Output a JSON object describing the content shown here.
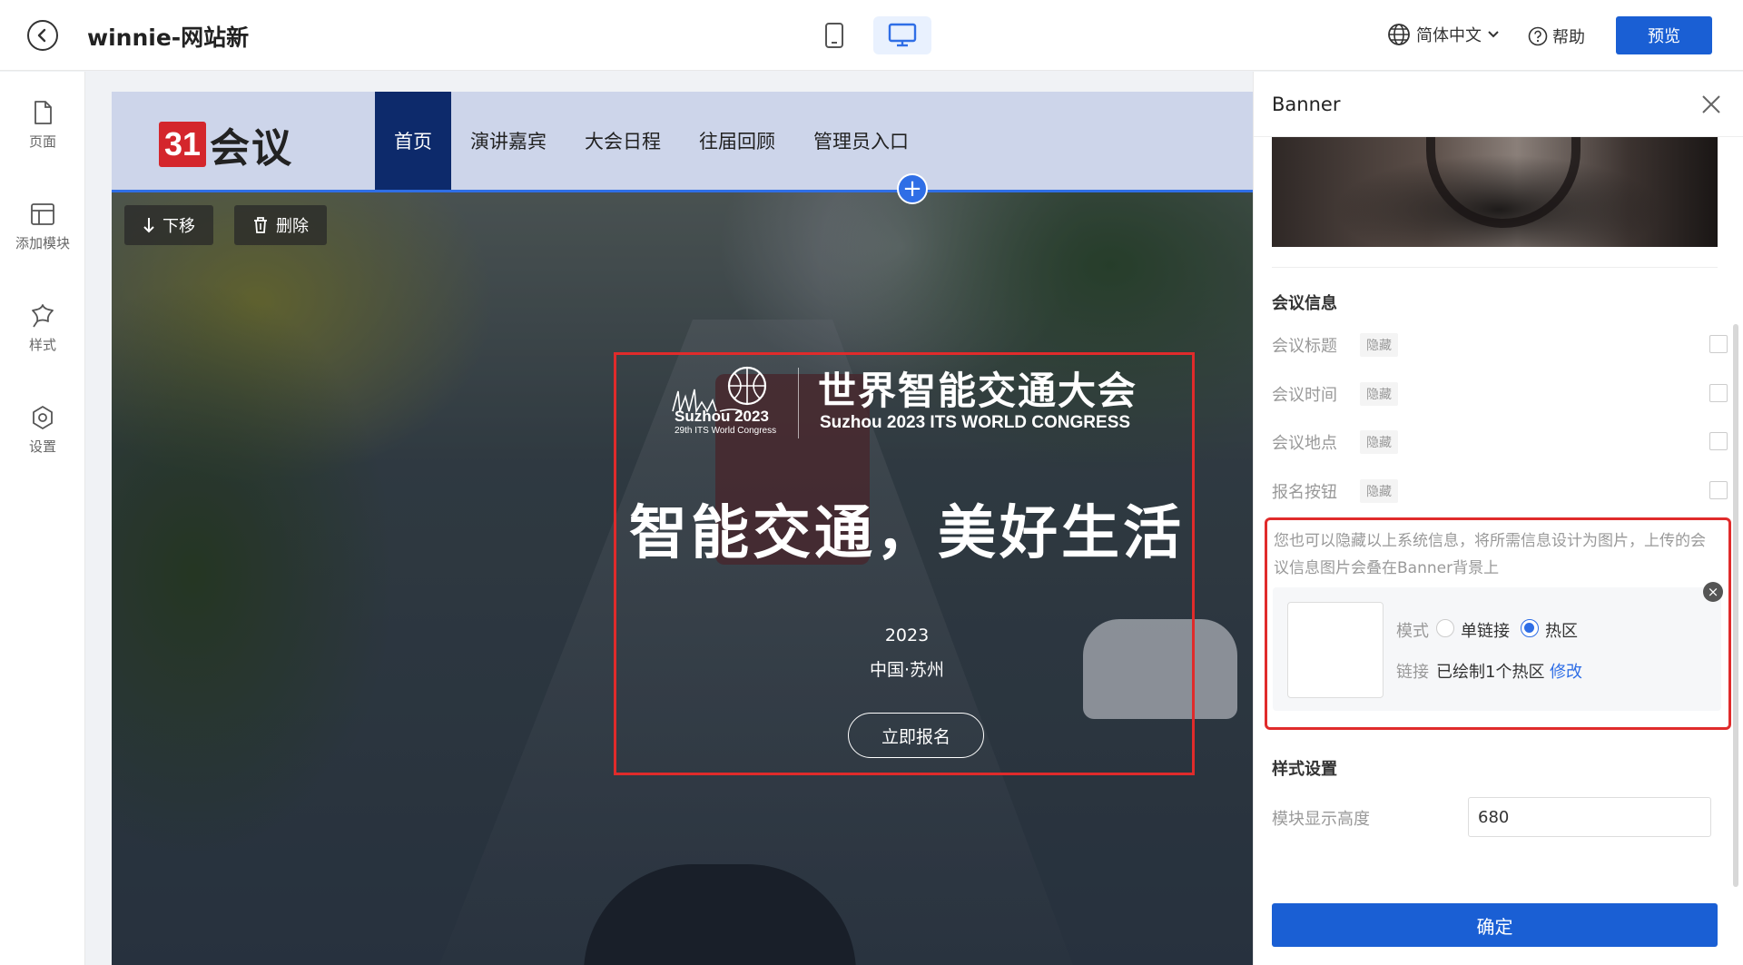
{
  "header": {
    "title": "winnie-网站新",
    "language": "简体中文",
    "help": "帮助",
    "preview": "预览"
  },
  "sidebar": {
    "items": [
      {
        "label": "页面",
        "icon": "page-icon"
      },
      {
        "label": "添加模块",
        "icon": "layout-icon"
      },
      {
        "label": "样式",
        "icon": "style-icon"
      },
      {
        "label": "设置",
        "icon": "settings-icon"
      }
    ]
  },
  "site": {
    "logo_number": "31",
    "logo_text": "会议",
    "nav": [
      "首页",
      "演讲嘉宾",
      "大会日程",
      "往届回顾",
      "管理员入口"
    ],
    "active_nav": "首页"
  },
  "block_toolbar": {
    "move_down": "下移",
    "delete": "删除"
  },
  "banner": {
    "congress_logo_text": "Suzhou 2023",
    "congress_logo_sub": "29th ITS World Congress",
    "title": "世界智能交通大会",
    "subtitle_en": "Suzhou 2023 ITS WORLD CONGRESS",
    "slogan": "智能交通，美好生活",
    "year": "2023",
    "location": "中国·苏州",
    "signup": "立即报名"
  },
  "panel": {
    "title": "Banner",
    "meeting_section": "会议信息",
    "fields": [
      {
        "label": "会议标题",
        "tag": "隐藏",
        "checked": false
      },
      {
        "label": "会议时间",
        "tag": "隐藏",
        "checked": false
      },
      {
        "label": "会议地点",
        "tag": "隐藏",
        "checked": false
      },
      {
        "label": "报名按钮",
        "tag": "隐藏",
        "checked": false
      }
    ],
    "hint": "您也可以隐藏以上系统信息，将所需信息设计为图片，上传的会议信息图片会叠在Banner背景上",
    "mode_label": "模式",
    "mode_options": [
      "单链接",
      "热区"
    ],
    "mode_selected": "热区",
    "link_label": "链接",
    "link_value": "已绘制1个热区",
    "link_edit": "修改",
    "style_section": "样式设置",
    "height_label": "模块显示高度",
    "height_value": "680",
    "confirm": "确定"
  },
  "colors": {
    "primary": "#1a5fd4",
    "nav_active": "#0d2a6b",
    "highlight": "#e02b2b",
    "site_nav_bg": "#cdd5ea"
  }
}
